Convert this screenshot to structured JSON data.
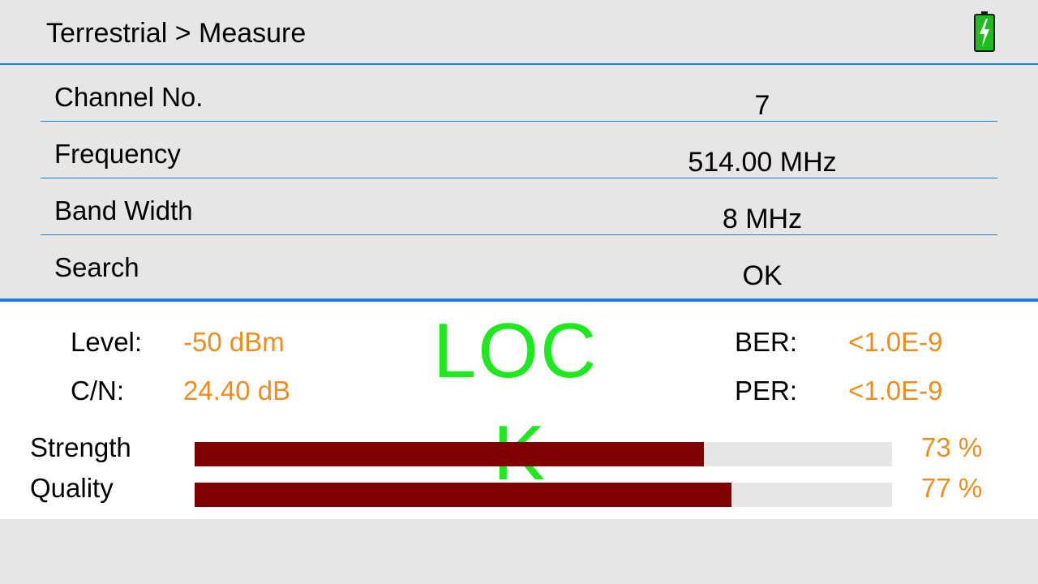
{
  "header": {
    "breadcrumb": "Terrestrial > Measure",
    "battery_icon": "battery-charging-icon",
    "battery_color": "#1ebc1e"
  },
  "params": [
    {
      "label": "Channel No.",
      "value": "7"
    },
    {
      "label": "Frequency",
      "value": "514.00 MHz"
    },
    {
      "label": "Band Width",
      "value": "8 MHz"
    },
    {
      "label": "Search",
      "value": "OK"
    }
  ],
  "measure": {
    "level_label": "Level:",
    "level_value": "-50 dBm",
    "cn_label": "C/N:",
    "cn_value": "24.40 dB",
    "ber_label": "BER:",
    "ber_value": "<1.0E-9",
    "per_label": "PER:",
    "per_value": "<1.0E-9",
    "lock_status": "LOC",
    "lock_status_extra": "K",
    "lock_color": "#1ee81e",
    "value_color": "#f08c1e"
  },
  "bars": [
    {
      "label": "Strength",
      "percent": 73,
      "percent_text": "73 %"
    },
    {
      "label": "Quality",
      "percent": 77,
      "percent_text": "77 %"
    }
  ],
  "colors": {
    "accent_line": "#1e7fd8",
    "bar_fill": "#7f0000",
    "bar_track": "#e6e6e6",
    "background": "#e6e6e6"
  }
}
